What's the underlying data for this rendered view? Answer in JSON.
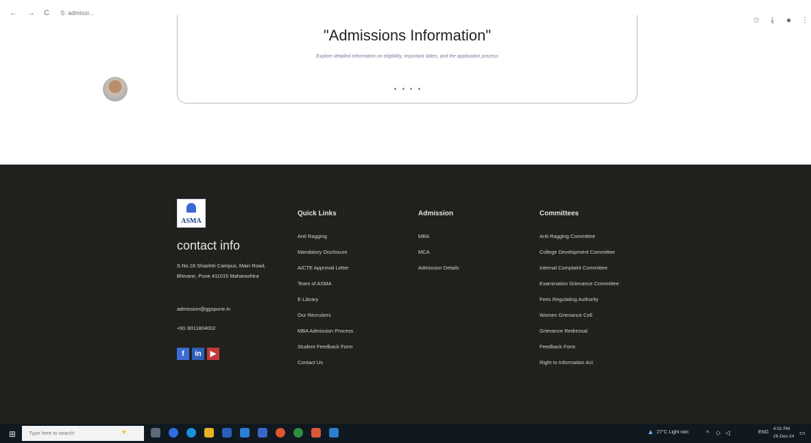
{
  "browser": {
    "url": "S: admissi...",
    "nav_back": "←",
    "nav_forward": "→",
    "reload": "C"
  },
  "hero": {
    "title": "\"Admissions Information\"",
    "subtitle": "Explore detailed information on eligibility, important dates, and the application process"
  },
  "footer": {
    "logo_text": "ASMA",
    "contact_title": "contact info",
    "address": "S.No.18 Shashtri Campus, Main Road, Bhivane, Pune 411015 Maharashtra",
    "email": "admission@ggspune.in",
    "phone": "+91-9011804002",
    "social": {
      "facebook": "f",
      "linkedin": "in",
      "youtube": "▶"
    },
    "quick_links": {
      "title": "Quick Links",
      "items": [
        "Anti Ragging",
        "Mandatory Disclosure",
        "AICTE Approval Letter",
        "Team of ASMA",
        "E-Library",
        "Our Recruiters",
        "MBA Admission Process",
        "Student Feedback Form",
        "Contact Us"
      ]
    },
    "admission": {
      "title": "Admission",
      "items": [
        "MBA",
        "MCA",
        "Admission Details"
      ]
    },
    "committees": {
      "title": "Committees",
      "items": [
        "Anti Ragging Committee",
        "College Development Committee",
        "Internal Complaint Committee",
        "Examination Grievance Committee",
        "Fees Regulating Authority",
        "Women Grievance Cell",
        "Grievance Redressal",
        "Feedback Form",
        "Right to Information Act"
      ]
    }
  },
  "taskbar": {
    "search_placeholder": "Type here to search",
    "weather": "27°C Light rain",
    "language": "ENG",
    "time": "4:02 PM",
    "date": "26-Dec-24"
  },
  "colors": {
    "footer_bg": "#1f1f1b",
    "taskbar_bg": "#101820",
    "facebook": "#3b6bd6",
    "linkedin": "#2f5fb8",
    "youtube": "#c33a3a"
  }
}
